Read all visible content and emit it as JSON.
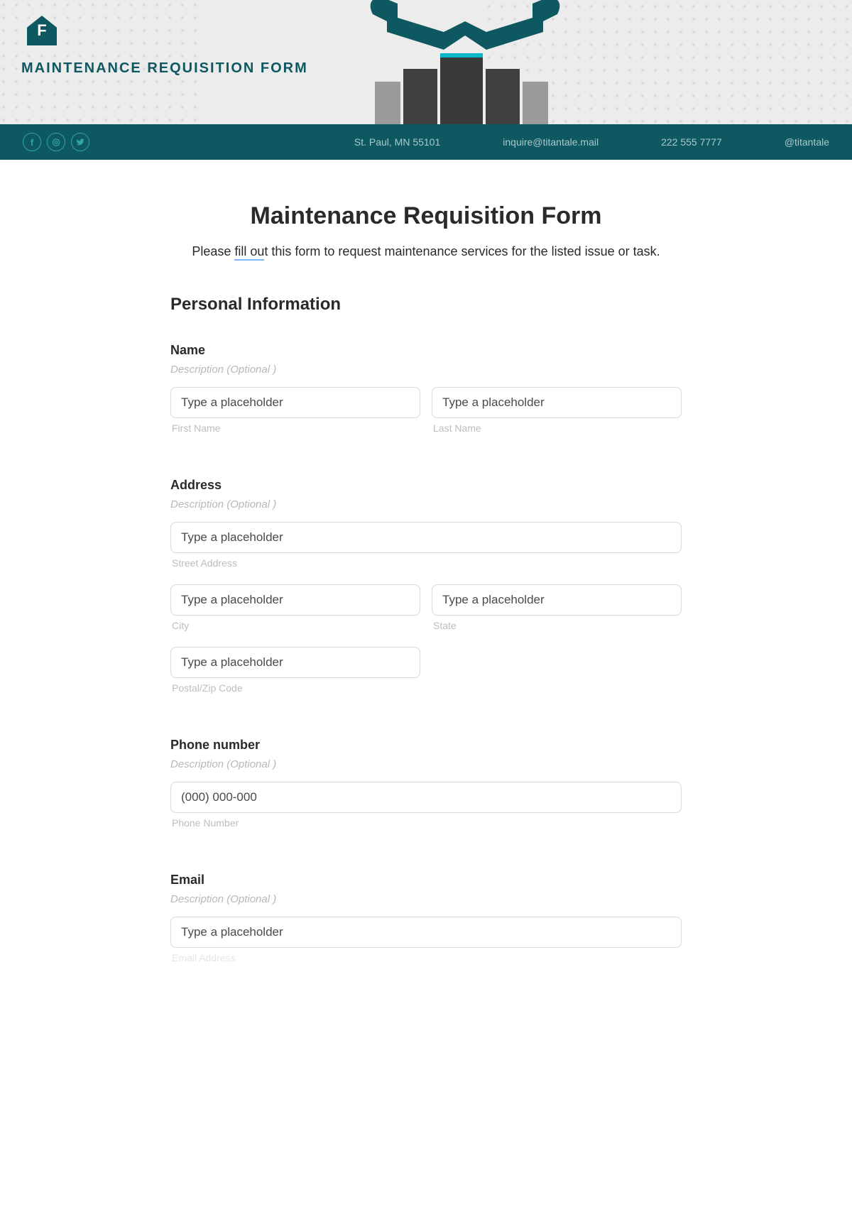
{
  "hero": {
    "logo_letter": "F",
    "title": "MAINTENANCE REQUISITION FORM"
  },
  "contact": {
    "address": "St. Paul, MN 55101",
    "email": "inquire@titantale.mail",
    "phone": "222 555 7777",
    "handle": "@titantale"
  },
  "form": {
    "title": "Maintenance Requisition Form",
    "intro_before": "Please ",
    "intro_under": "fill ou",
    "intro_after": "t this form to request maintenance services for the listed issue or task.",
    "section_personal": "Personal Information",
    "desc_optional": "Description  (Optional )",
    "name": {
      "label": "Name",
      "first_ph": "Type a placeholder",
      "last_ph": "Type a placeholder",
      "first_sub": "First Name",
      "last_sub": "Last Name"
    },
    "address": {
      "label": "Address",
      "street_ph": "Type a placeholder",
      "street_sub": "Street Address",
      "city_ph": "Type a placeholder",
      "city_sub": "City",
      "state_ph": "Type a placeholder",
      "state_sub": "State",
      "zip_ph": "Type a placeholder",
      "zip_sub": "Postal/Zip Code"
    },
    "phone": {
      "label": "Phone number",
      "ph": "(000) 000-000",
      "sub": "Phone Number"
    },
    "email": {
      "label": "Email",
      "ph": "Type a placeholder",
      "sub": "Email Address"
    }
  }
}
